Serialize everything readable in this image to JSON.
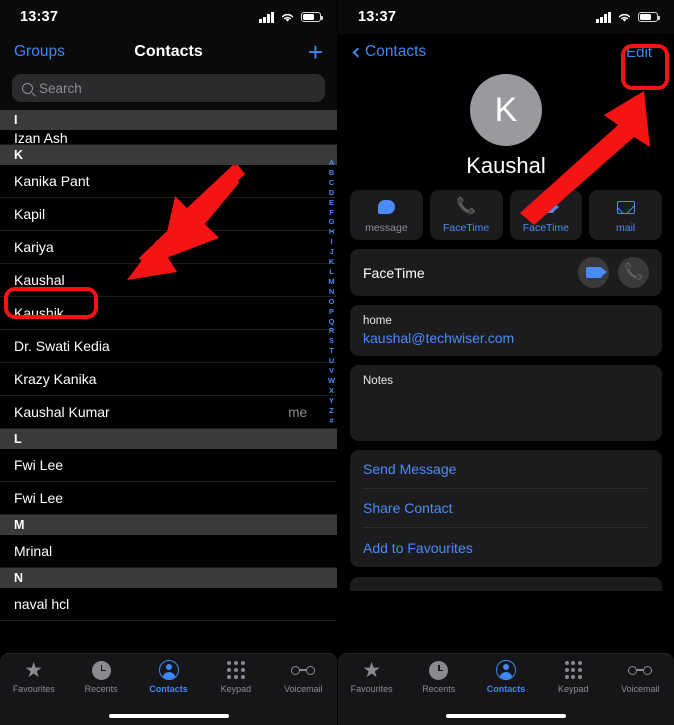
{
  "status_bar": {
    "time": "13:37",
    "signal_icon": "cellular-bars-icon",
    "wifi_icon": "wifi-icon",
    "battery_icon": "battery-icon"
  },
  "left_screen": {
    "nav": {
      "groups_label": "Groups",
      "title": "Contacts",
      "add_label": "+"
    },
    "search": {
      "placeholder": "Search"
    },
    "sections": [
      {
        "letter": "I",
        "rows": [
          {
            "name": "Izan Ash",
            "meta": "",
            "clipped": true
          }
        ]
      },
      {
        "letter": "K",
        "rows": [
          {
            "name": "Kanika Pant",
            "meta": ""
          },
          {
            "name": "Kapil",
            "meta": ""
          },
          {
            "name": "Kariya",
            "meta": ""
          },
          {
            "name": "Kaushal",
            "meta": "",
            "highlighted": true
          },
          {
            "name": "Kaushik",
            "meta": ""
          },
          {
            "name": "Dr. Swati Kedia",
            "meta": ""
          },
          {
            "name": "Krazy Kanika",
            "meta": ""
          },
          {
            "name": "Kaushal Kumar",
            "meta": "me"
          }
        ]
      },
      {
        "letter": "L",
        "rows": [
          {
            "name": "Fwi Lee",
            "meta": ""
          },
          {
            "name": "Fwi Lee",
            "meta": ""
          }
        ]
      },
      {
        "letter": "M",
        "rows": [
          {
            "name": "Mrinal",
            "meta": ""
          }
        ]
      },
      {
        "letter": "N",
        "rows": [
          {
            "name": "naval hcl",
            "meta": ""
          }
        ]
      }
    ],
    "index": [
      "A",
      "B",
      "C",
      "D",
      "E",
      "F",
      "G",
      "H",
      "I",
      "J",
      "K",
      "L",
      "M",
      "N",
      "O",
      "P",
      "Q",
      "R",
      "S",
      "T",
      "U",
      "V",
      "W",
      "X",
      "Y",
      "Z",
      "#"
    ]
  },
  "right_screen": {
    "nav": {
      "back_label": "Contacts",
      "edit_label": "Edit"
    },
    "contact": {
      "initial": "K",
      "name": "Kaushal"
    },
    "actions": [
      {
        "label": "message",
        "icon": "message-bubble-icon",
        "dim": true
      },
      {
        "label": "FaceTime",
        "icon": "phone-handset-icon",
        "dim": false
      },
      {
        "label": "FaceTime",
        "icon": "video-camera-icon",
        "dim": false
      },
      {
        "label": "mail",
        "icon": "envelope-icon",
        "dim": false
      }
    ],
    "facetime_row": {
      "label": "FaceTime",
      "video_icon": "video-camera-icon",
      "audio_icon": "phone-handset-icon"
    },
    "email": {
      "label": "home",
      "value": "kaushal@techwiser.com"
    },
    "notes": {
      "label": "Notes",
      "value": ""
    },
    "links": [
      "Send Message",
      "Share Contact",
      "Add to Favourites"
    ]
  },
  "tab_bar": {
    "tabs": [
      {
        "label": "Favourites",
        "icon": "star-icon",
        "active": false
      },
      {
        "label": "Recents",
        "icon": "clock-icon",
        "active": false
      },
      {
        "label": "Contacts",
        "icon": "person-circle-icon",
        "active": true
      },
      {
        "label": "Keypad",
        "icon": "keypad-dots-icon",
        "active": false
      },
      {
        "label": "Voicemail",
        "icon": "voicemail-icon",
        "active": false
      }
    ]
  },
  "annotations": {
    "accent_color": "#f41414",
    "highlight_box_left": "Kaushal",
    "arrow_left": "arrow-pointing-down-left",
    "highlight_box_right": "Edit",
    "arrow_right": "arrow-pointing-up-right"
  }
}
